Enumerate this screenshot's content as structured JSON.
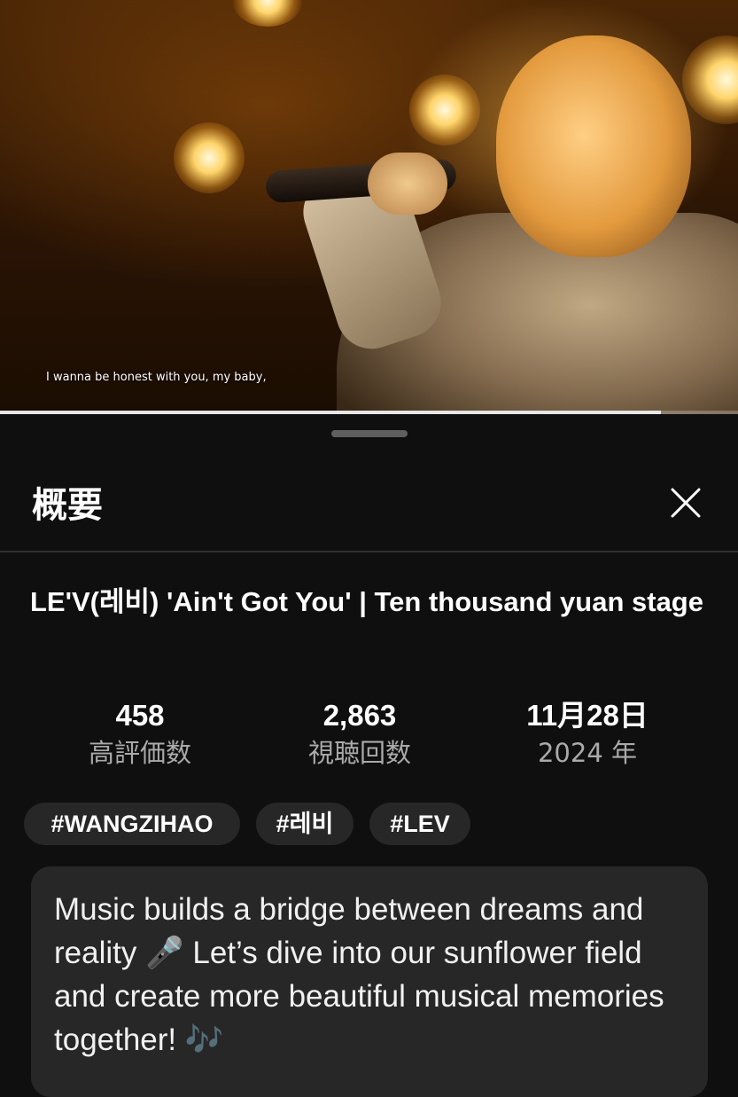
{
  "video": {
    "subtitle": "I wanna be honest with you, my baby,",
    "progress_fraction": 0.895
  },
  "sheet": {
    "title": "概要",
    "close_icon": "close-icon"
  },
  "details": {
    "title": "LE'V(레비) 'Ain't Got You' | Ten thousand yuan stage",
    "stats": [
      {
        "value": "458",
        "label": "高評価数"
      },
      {
        "value": "2,863",
        "label": "視聴回数"
      },
      {
        "value": "11月28日",
        "label": "2024 年"
      }
    ],
    "hashtags": [
      "#WANGZIHAO",
      "#레비",
      "#LEV"
    ],
    "description": "Music builds a bridge between dreams and reality 🎤 Let’s dive into our sunflower field and create more beautiful musical memories together! 🎶"
  }
}
